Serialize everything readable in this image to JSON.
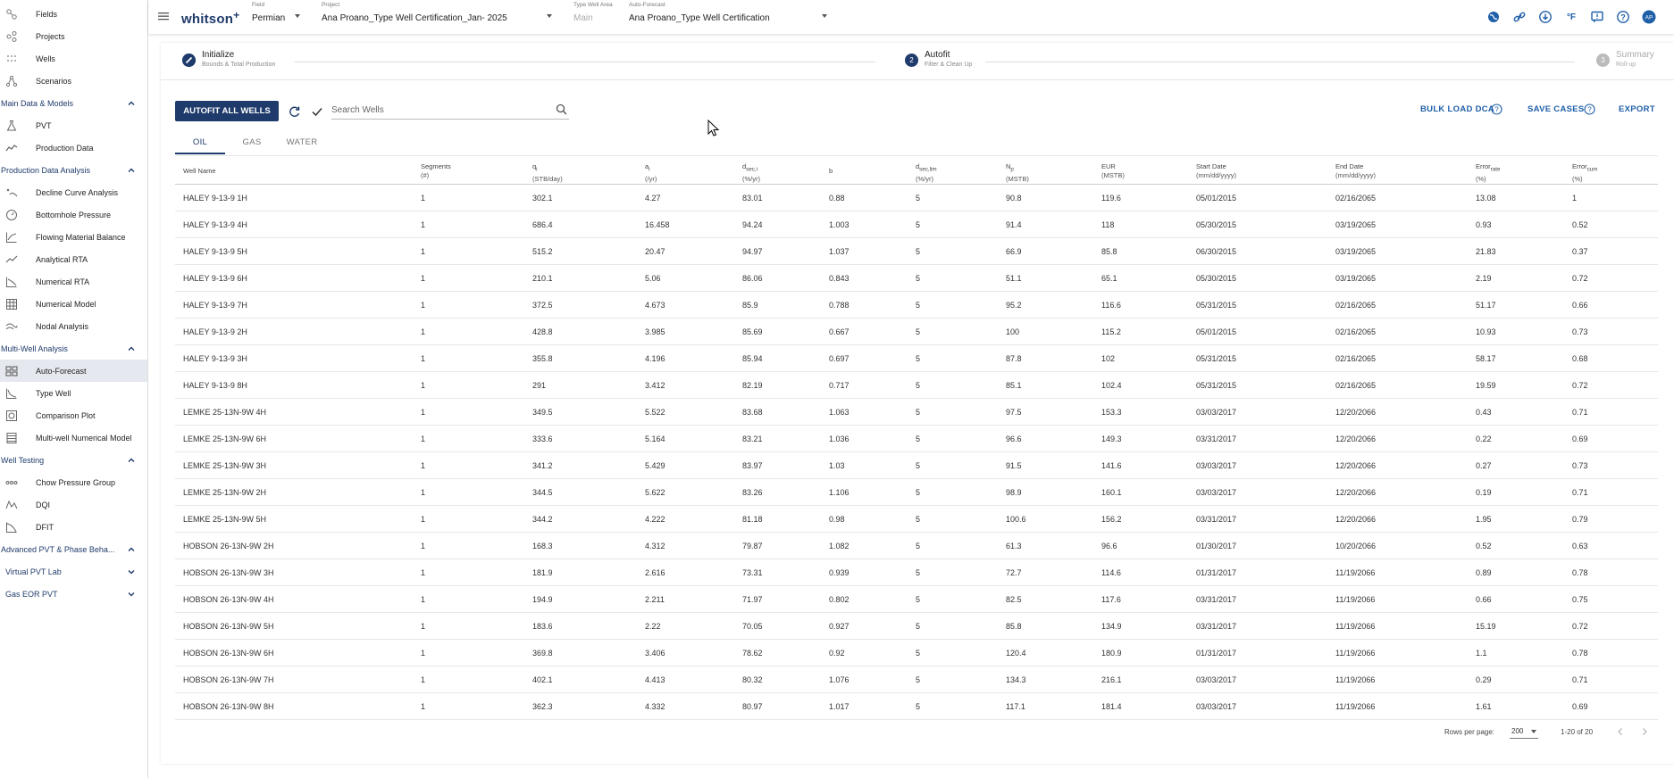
{
  "sidebar": {
    "top_items": [
      {
        "label": "Fields",
        "icon": "fields-icon"
      },
      {
        "label": "Projects",
        "icon": "projects-icon"
      },
      {
        "label": "Wells",
        "icon": "wells-icon"
      },
      {
        "label": "Scenarios",
        "icon": "scenarios-icon"
      }
    ],
    "sections": [
      {
        "label": "Main Data & Models",
        "items": [
          {
            "label": "PVT",
            "icon": "flask-icon"
          },
          {
            "label": "Production Data",
            "icon": "line-chart-icon"
          }
        ]
      },
      {
        "label": "Production Data Analysis",
        "items": [
          {
            "label": "Decline Curve Analysis",
            "icon": "decline-curve-icon"
          },
          {
            "label": "Bottomhole Pressure",
            "icon": "gauge-icon"
          },
          {
            "label": "Flowing Material Balance",
            "icon": "chart-icon"
          },
          {
            "label": "Analytical RTA",
            "icon": "trend-icon"
          },
          {
            "label": "Numerical RTA",
            "icon": "numerical-rta-icon"
          },
          {
            "label": "Numerical Model",
            "icon": "grid-icon"
          },
          {
            "label": "Nodal Analysis",
            "icon": "nodal-icon"
          }
        ]
      },
      {
        "label": "Multi-Well Analysis",
        "items": [
          {
            "label": "Auto-Forecast",
            "icon": "auto-forecast-icon"
          },
          {
            "label": "Type Well",
            "icon": "type-well-icon"
          },
          {
            "label": "Comparison Plot",
            "icon": "comparison-icon"
          },
          {
            "label": "Multi-well Numerical Model",
            "icon": "multiwell-icon"
          }
        ]
      },
      {
        "label": "Well Testing",
        "items": [
          {
            "label": "Chow Pressure Group",
            "icon": "dots-icon"
          },
          {
            "label": "DQI",
            "icon": "dqi-icon"
          },
          {
            "label": "DFIT",
            "icon": "dfit-icon"
          }
        ]
      },
      {
        "label": "Advanced PVT & Phase Beha...",
        "items": []
      }
    ],
    "sub_sections": [
      "Virtual PVT Lab",
      "Gas EOR PVT"
    ],
    "active_item": "Auto-Forecast"
  },
  "topbar": {
    "logo": "whitson",
    "logo_plus": "+",
    "field_caption": "Field",
    "field_value": "Permian",
    "project_caption": "Project",
    "project_value": "Ana Proano_Type Well Certification_Jan- 2025",
    "type_well_area_caption": "Type Well Area",
    "type_well_area_value": "Main",
    "auto_forecast_caption": "Auto-Forecast",
    "auto_forecast_value": "Ana Proano_Type Well Certification",
    "icons": [
      "globe-icon",
      "link-icon",
      "download-icon",
      "fahrenheit-icon",
      "feedback-icon",
      "help-icon",
      "avatar-icon"
    ],
    "fahrenheit": "°F",
    "avatar": "AP"
  },
  "stepper": {
    "steps": [
      {
        "title": "Initialize",
        "subtitle": "Bounds & Total Production",
        "status": "done"
      },
      {
        "number": "2",
        "title": "Autofit",
        "subtitle": "Filter & Clean Up",
        "status": "active"
      },
      {
        "number": "3",
        "title": "Summary",
        "subtitle": "Roll-up",
        "status": "pending"
      }
    ]
  },
  "toolbar": {
    "autofit_label": "AUTOFIT ALL WELLS",
    "search_placeholder": "Search Wells",
    "bulk_load_label": "BULK LOAD DCA",
    "save_cases_label": "SAVE CASES",
    "export_label": "EXPORT"
  },
  "tabs": [
    {
      "label": "OIL",
      "active": true
    },
    {
      "label": "GAS",
      "active": false
    },
    {
      "label": "WATER",
      "active": false
    }
  ],
  "table": {
    "columns": [
      {
        "label": "Well Name",
        "unit": ""
      },
      {
        "label": "Segments",
        "unit": "(#)"
      },
      {
        "label": "qi",
        "unit": "(STB/day)"
      },
      {
        "label": "ai",
        "unit": "(/yr)"
      },
      {
        "label": "dsec,i",
        "unit": "(%/yr)"
      },
      {
        "label": "b",
        "unit": ""
      },
      {
        "label": "dsec,lim",
        "unit": "(%/yr)"
      },
      {
        "label": "Np",
        "unit": "(MSTB)"
      },
      {
        "label": "EUR",
        "unit": "(MSTB)"
      },
      {
        "label": "Start Date",
        "unit": "(mm/dd/yyyy)"
      },
      {
        "label": "End Date",
        "unit": "(mm/dd/yyyy)"
      },
      {
        "label": "Errorrate",
        "unit": "(%)"
      },
      {
        "label": "Errorcum",
        "unit": "(%)"
      }
    ],
    "rows": [
      [
        "HALEY 9-13-9 1H",
        "1",
        "302.1",
        "4.27",
        "83.01",
        "0.88",
        "5",
        "90.8",
        "119.6",
        "05/01/2015",
        "02/16/2065",
        "13.08",
        "1"
      ],
      [
        "HALEY 9-13-9 4H",
        "1",
        "686.4",
        "16.458",
        "94.24",
        "1.003",
        "5",
        "91.4",
        "118",
        "05/30/2015",
        "03/19/2065",
        "0.93",
        "0.52"
      ],
      [
        "HALEY 9-13-9 5H",
        "1",
        "515.2",
        "20.47",
        "94.97",
        "1.037",
        "5",
        "66.9",
        "85.8",
        "06/30/2015",
        "03/19/2065",
        "21.83",
        "0.37"
      ],
      [
        "HALEY 9-13-9 6H",
        "1",
        "210.1",
        "5.06",
        "86.06",
        "0.843",
        "5",
        "51.1",
        "65.1",
        "05/30/2015",
        "03/19/2065",
        "2.19",
        "0.72"
      ],
      [
        "HALEY 9-13-9 7H",
        "1",
        "372.5",
        "4.673",
        "85.9",
        "0.788",
        "5",
        "95.2",
        "116.6",
        "05/31/2015",
        "02/16/2065",
        "51.17",
        "0.66"
      ],
      [
        "HALEY 9-13-9 2H",
        "1",
        "428.8",
        "3.985",
        "85.69",
        "0.667",
        "5",
        "100",
        "115.2",
        "05/01/2015",
        "02/16/2065",
        "10.93",
        "0.73"
      ],
      [
        "HALEY 9-13-9 3H",
        "1",
        "355.8",
        "4.196",
        "85.94",
        "0.697",
        "5",
        "87.8",
        "102",
        "05/31/2015",
        "02/16/2065",
        "58.17",
        "0.68"
      ],
      [
        "HALEY 9-13-9 8H",
        "1",
        "291",
        "3.412",
        "82.19",
        "0.717",
        "5",
        "85.1",
        "102.4",
        "05/31/2015",
        "02/16/2065",
        "19.59",
        "0.72"
      ],
      [
        "LEMKE 25-13N-9W 4H",
        "1",
        "349.5",
        "5.522",
        "83.68",
        "1.063",
        "5",
        "97.5",
        "153.3",
        "03/03/2017",
        "12/20/2066",
        "0.43",
        "0.71"
      ],
      [
        "LEMKE 25-13N-9W 6H",
        "1",
        "333.6",
        "5.164",
        "83.21",
        "1.036",
        "5",
        "96.6",
        "149.3",
        "03/31/2017",
        "12/20/2066",
        "0.22",
        "0.69"
      ],
      [
        "LEMKE 25-13N-9W 3H",
        "1",
        "341.2",
        "5.429",
        "83.97",
        "1.03",
        "5",
        "91.5",
        "141.6",
        "03/03/2017",
        "12/20/2066",
        "0.27",
        "0.73"
      ],
      [
        "LEMKE 25-13N-9W 2H",
        "1",
        "344.5",
        "5.622",
        "83.26",
        "1.106",
        "5",
        "98.9",
        "160.1",
        "03/03/2017",
        "12/20/2066",
        "0.19",
        "0.71"
      ],
      [
        "LEMKE 25-13N-9W 5H",
        "1",
        "344.2",
        "4.222",
        "81.18",
        "0.98",
        "5",
        "100.6",
        "156.2",
        "03/31/2017",
        "12/20/2066",
        "1.95",
        "0.79"
      ],
      [
        "HOBSON 26-13N-9W 2H",
        "1",
        "168.3",
        "4.312",
        "79.87",
        "1.082",
        "5",
        "61.3",
        "96.6",
        "01/30/2017",
        "10/20/2066",
        "0.52",
        "0.63"
      ],
      [
        "HOBSON 26-13N-9W 3H",
        "1",
        "181.9",
        "2.616",
        "73.31",
        "0.939",
        "5",
        "72.7",
        "114.6",
        "01/31/2017",
        "11/19/2066",
        "0.89",
        "0.78"
      ],
      [
        "HOBSON 26-13N-9W 4H",
        "1",
        "194.9",
        "2.211",
        "71.97",
        "0.802",
        "5",
        "82.5",
        "117.6",
        "03/31/2017",
        "11/19/2066",
        "0.66",
        "0.75"
      ],
      [
        "HOBSON 26-13N-9W 5H",
        "1",
        "183.6",
        "2.22",
        "70.05",
        "0.927",
        "5",
        "85.8",
        "134.9",
        "03/31/2017",
        "11/19/2066",
        "15.19",
        "0.72"
      ],
      [
        "HOBSON 26-13N-9W 6H",
        "1",
        "369.8",
        "3.406",
        "78.62",
        "0.92",
        "5",
        "120.4",
        "180.9",
        "01/31/2017",
        "11/19/2066",
        "1.1",
        "0.78"
      ],
      [
        "HOBSON 26-13N-9W 7H",
        "1",
        "402.1",
        "4.413",
        "80.32",
        "1.076",
        "5",
        "134.3",
        "216.1",
        "03/03/2017",
        "11/19/2066",
        "0.29",
        "0.71"
      ],
      [
        "HOBSON 26-13N-9W 8H",
        "1",
        "362.3",
        "4.332",
        "80.97",
        "1.017",
        "5",
        "117.1",
        "181.4",
        "03/03/2017",
        "11/19/2066",
        "1.61",
        "0.69"
      ]
    ]
  },
  "footer": {
    "rows_per_page_label": "Rows per page:",
    "rows_per_page_value": "200",
    "range_text": "1-20 of 20"
  },
  "colors": {
    "primary": "#1f3b6b",
    "link": "#1f5fa8",
    "active_bg": "#e5e8ee"
  }
}
